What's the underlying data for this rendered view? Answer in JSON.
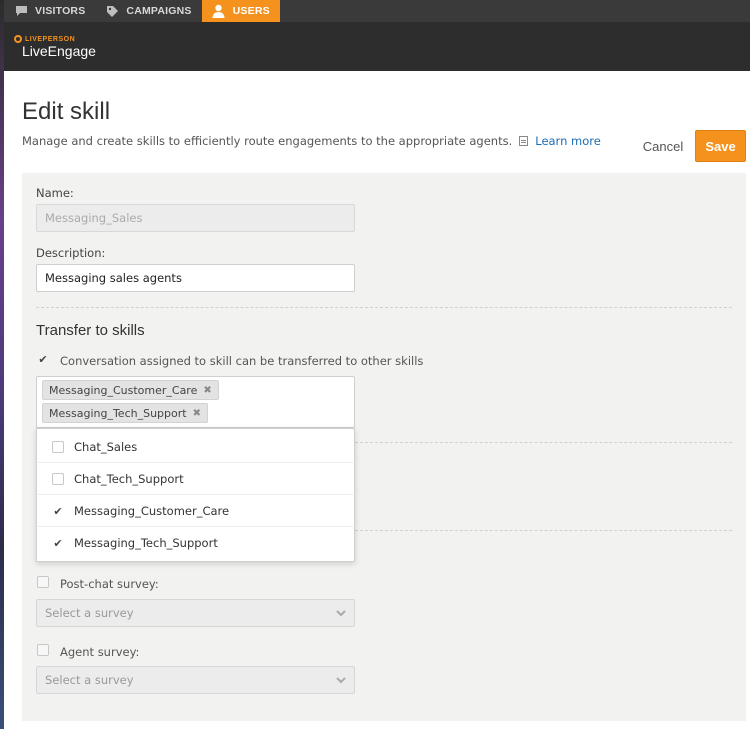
{
  "nav": {
    "tabs": [
      {
        "label": "VISITORS",
        "icon": "chat-bubble-icon",
        "active": false
      },
      {
        "label": "CAMPAIGNS",
        "icon": "tag-icon",
        "active": false
      },
      {
        "label": "USERS",
        "icon": "user-icon",
        "active": true
      }
    ],
    "accent_color": "#f5921e"
  },
  "brand": {
    "small": "LIVEPERSON",
    "main": "LiveEngage"
  },
  "header": {
    "title": "Edit skill",
    "subtitle": "Manage and create skills to efficiently route engagements to the appropriate agents.",
    "learn_more": "Learn more",
    "cancel_label": "Cancel",
    "save_label": "Save"
  },
  "form": {
    "name_label": "Name:",
    "name_value": "Messaging_Sales",
    "description_label": "Description:",
    "description_value": "Messaging sales agents",
    "transfer": {
      "title": "Transfer to skills",
      "checkbox_label": "Conversation assigned to skill can be transferred to other skills",
      "checkbox_checked": true,
      "selected_tags": [
        "Messaging_Customer_Care",
        "Messaging_Tech_Support"
      ],
      "options": [
        {
          "label": "Chat_Sales",
          "checked": false
        },
        {
          "label": "Chat_Tech_Support",
          "checked": false
        },
        {
          "label": "Messaging_Customer_Care",
          "checked": true
        },
        {
          "label": "Messaging_Tech_Support",
          "checked": true
        }
      ]
    },
    "post_chat_survey": {
      "label": "Post-chat survey:",
      "checked": false,
      "placeholder": "Select a survey"
    },
    "agent_survey": {
      "label": "Agent survey:",
      "checked": false,
      "placeholder": "Select a survey"
    }
  }
}
